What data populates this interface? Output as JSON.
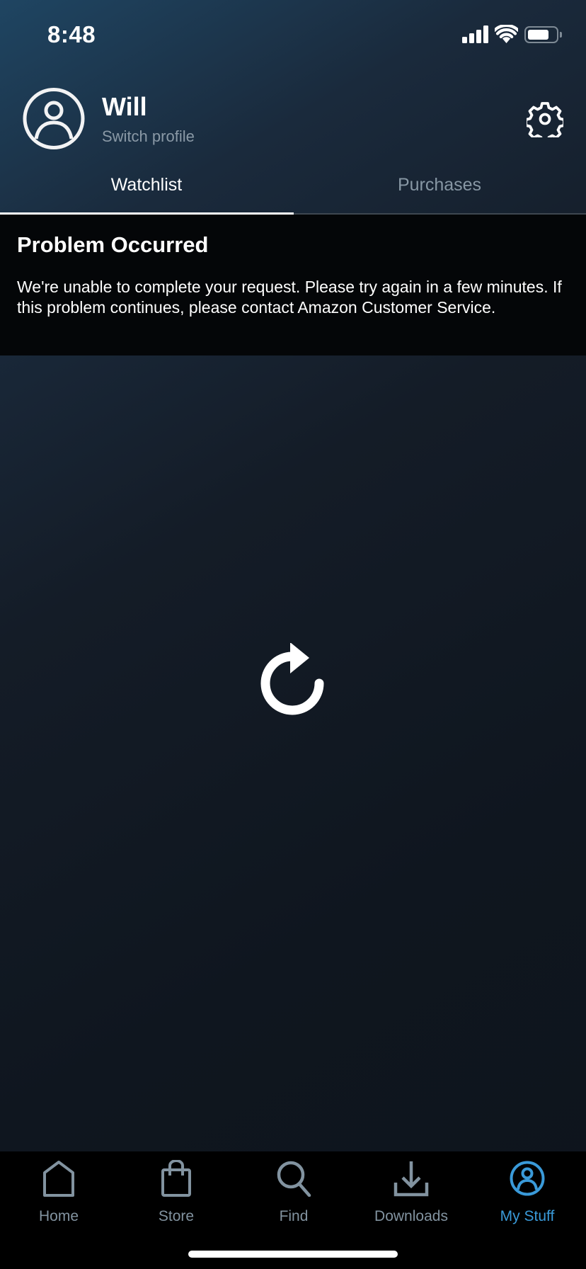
{
  "status_bar": {
    "time": "8:48",
    "battery_level_percent": 75,
    "icons": [
      "cellular-signal-icon",
      "wifi-icon",
      "battery-icon"
    ]
  },
  "profile": {
    "name": "Will",
    "switch_label": "Switch profile",
    "avatar_icon": "user-circle-icon",
    "settings_icon": "gear-icon"
  },
  "tabs": [
    {
      "label": "Watchlist",
      "active": true
    },
    {
      "label": "Purchases",
      "active": false
    }
  ],
  "error": {
    "title": "Problem Occurred",
    "message": "We're unable to complete your request. Please try again in a few minutes. If this problem continues, please contact Amazon Customer Service."
  },
  "retry": {
    "icon": "refresh-icon"
  },
  "bottom_nav": {
    "items": [
      {
        "label": "Home",
        "icon": "home-icon",
        "active": false
      },
      {
        "label": "Store",
        "icon": "shopping-bag-icon",
        "active": false
      },
      {
        "label": "Find",
        "icon": "search-icon",
        "active": false
      },
      {
        "label": "Downloads",
        "icon": "download-icon",
        "active": false
      },
      {
        "label": "My Stuff",
        "icon": "user-circle-icon",
        "active": true
      }
    ]
  },
  "colors": {
    "accent": "#3a9ad9",
    "inactive_nav": "#8293a0",
    "error_background": "#040608",
    "header_gradient_start": "#1f4562",
    "page_background": "#0f161f"
  }
}
